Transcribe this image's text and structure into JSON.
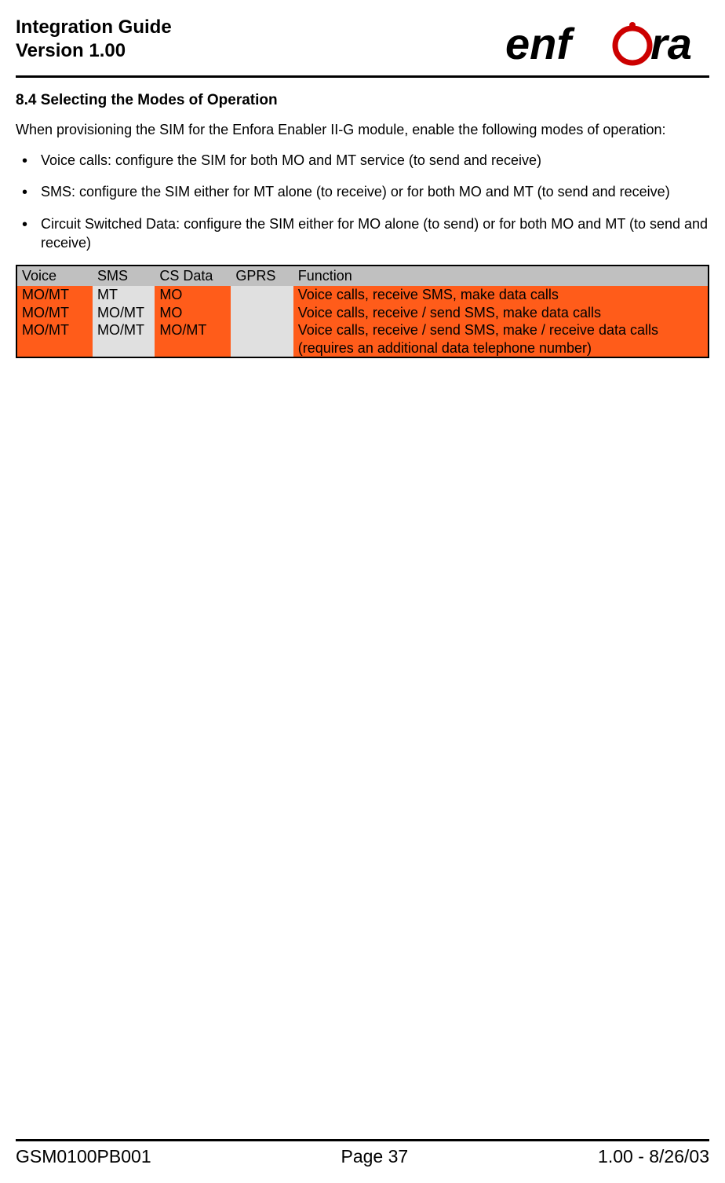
{
  "header": {
    "title_line1": "Integration Guide",
    "title_line2": "Version 1.00",
    "logo_text": "enfora"
  },
  "section": {
    "number": "8.4",
    "title": "Selecting the Modes of Operation",
    "intro": "When provisioning the SIM for the Enfora Enabler II-G module, enable the following modes of operation:",
    "bullets": [
      "Voice calls: configure the SIM for both MO and MT service (to send and receive)",
      "SMS: configure the SIM either for MT alone (to receive) or for both MO and MT (to send and receive)",
      "Circuit Switched Data: configure the SIM either for MO alone (to send) or for both MO and MT (to send and receive)"
    ]
  },
  "table": {
    "headers": [
      "Voice",
      "SMS",
      "CS Data",
      "GPRS",
      "Function"
    ],
    "rows": [
      {
        "voice": "MO/MT",
        "sms": "MT",
        "csdata": "MO",
        "gprs": "",
        "function": "Voice calls, receive SMS, make data calls"
      },
      {
        "voice": "MO/MT",
        "sms": "MO/MT",
        "csdata": "MO",
        "gprs": "",
        "function": "Voice calls, receive / send SMS, make data calls"
      },
      {
        "voice": "MO/MT",
        "sms": "MO/MT",
        "csdata": "MO/MT",
        "gprs": "",
        "function": "Voice calls, receive / send SMS, make / receive data calls (requires an additional data telephone number)"
      }
    ]
  },
  "footer": {
    "left": "GSM0100PB001",
    "center": "Page 37",
    "right": "1.00 - 8/26/03"
  }
}
